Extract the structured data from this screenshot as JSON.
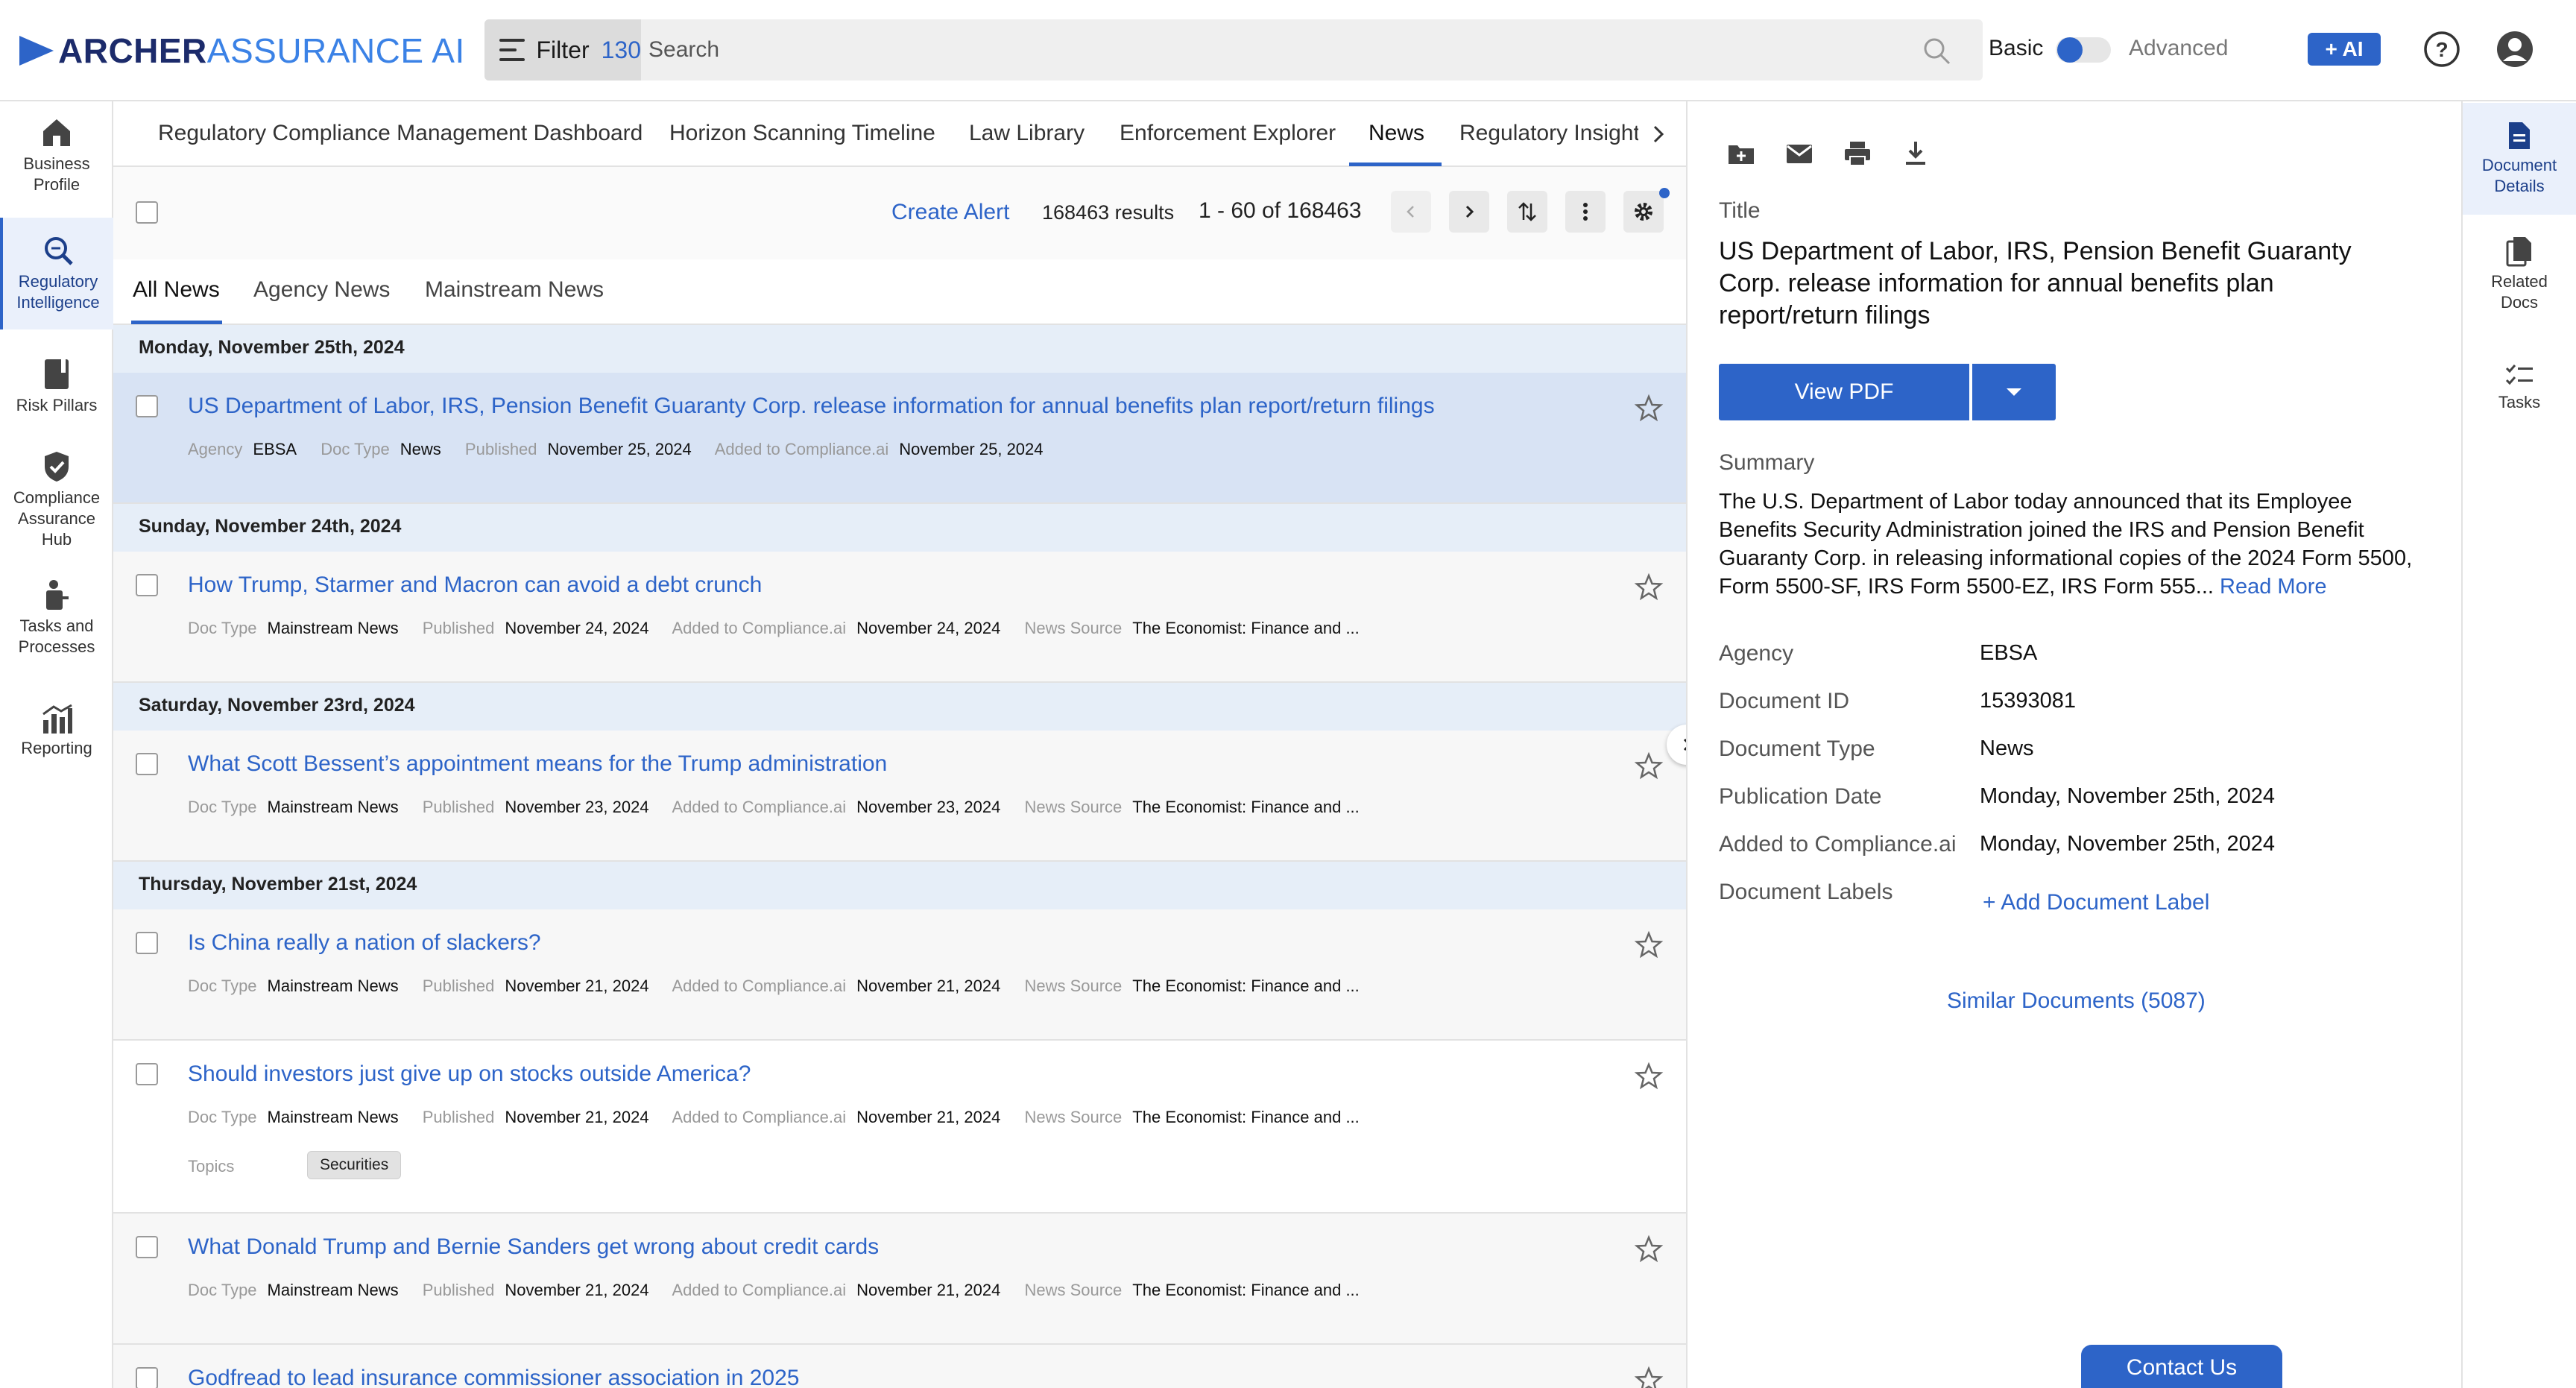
{
  "brand": {
    "part1": "ARCHER",
    "part2": "ASSURANCE AI"
  },
  "header": {
    "filter_label": "Filter",
    "filter_count": "130",
    "search_placeholder": "Search",
    "mode_basic": "Basic",
    "mode_advanced": "Advanced",
    "ai_label": "+ AI"
  },
  "left_nav": [
    {
      "label1": "Business",
      "label2": "Profile",
      "icon": "building-icon"
    },
    {
      "label1": "Regulatory",
      "label2": "Intelligence",
      "icon": "search-icon",
      "active": true
    },
    {
      "label1": "Risk Pillars",
      "label2": "",
      "icon": "book-icon"
    },
    {
      "label1": "Compliance",
      "label2": "Assurance",
      "label3": "Hub",
      "icon": "shield-icon"
    },
    {
      "label1": "Tasks and",
      "label2": "Processes",
      "icon": "task-icon"
    },
    {
      "label1": "Reporting",
      "label2": "",
      "icon": "chart-icon"
    }
  ],
  "main_tabs": [
    "Regulatory Compliance Management Dashboard",
    "Horizon Scanning Timeline",
    "Law Library",
    "Enforcement Explorer",
    "News",
    "Regulatory Insight"
  ],
  "toolbar": {
    "create_alert": "Create Alert",
    "results": "168463 results",
    "pager": "1 - 60 of 168463"
  },
  "sub_tabs": [
    "All News",
    "Agency News",
    "Mainstream News"
  ],
  "groups": [
    {
      "date": "Monday, November 25th, 2024"
    },
    {
      "date": "Sunday, November 24th, 2024"
    },
    {
      "date": "Saturday, November 23rd, 2024"
    },
    {
      "date": "Thursday, November 21st, 2024"
    }
  ],
  "items": [
    {
      "title": "US Department of Labor, IRS, Pension Benefit Guaranty Corp. release information for annual benefits plan report/return filings",
      "meta": [
        [
          "Agency",
          "EBSA"
        ],
        [
          "Doc Type",
          "News"
        ],
        [
          "Published",
          "November 25, 2024"
        ],
        [
          "Added to Compliance.ai",
          "November 25, 2024"
        ]
      ]
    },
    {
      "title": "How Trump, Starmer and Macron can avoid a debt crunch",
      "meta": [
        [
          "Doc Type",
          "Mainstream News"
        ],
        [
          "Published",
          "November 24, 2024"
        ],
        [
          "Added to Compliance.ai",
          "November 24, 2024"
        ],
        [
          "News Source",
          "The Economist: Finance and ..."
        ]
      ]
    },
    {
      "title": "What Scott Bessent’s appointment means for the Trump administration",
      "meta": [
        [
          "Doc Type",
          "Mainstream News"
        ],
        [
          "Published",
          "November 23, 2024"
        ],
        [
          "Added to Compliance.ai",
          "November 23, 2024"
        ],
        [
          "News Source",
          "The Economist: Finance and ..."
        ]
      ]
    },
    {
      "title": "Is China really a nation of slackers?",
      "meta": [
        [
          "Doc Type",
          "Mainstream News"
        ],
        [
          "Published",
          "November 21, 2024"
        ],
        [
          "Added to Compliance.ai",
          "November 21, 2024"
        ],
        [
          "News Source",
          "The Economist: Finance and ..."
        ]
      ]
    },
    {
      "title": "Should investors just give up on stocks outside America?",
      "meta": [
        [
          "Doc Type",
          "Mainstream News"
        ],
        [
          "Published",
          "November 21, 2024"
        ],
        [
          "Added to Compliance.ai",
          "November 21, 2024"
        ],
        [
          "News Source",
          "The Economist: Finance and ..."
        ]
      ],
      "topics_label": "Topics",
      "topic": "Securities"
    },
    {
      "title": "What Donald Trump and Bernie Sanders get wrong about credit cards",
      "meta": [
        [
          "Doc Type",
          "Mainstream News"
        ],
        [
          "Published",
          "November 21, 2024"
        ],
        [
          "Added to Compliance.ai",
          "November 21, 2024"
        ],
        [
          "News Source",
          "The Economist: Finance and ..."
        ]
      ]
    },
    {
      "title": "Godfread to lead insurance commissioner association in 2025",
      "meta": []
    }
  ],
  "details": {
    "title_label": "Title",
    "title": "US Department of Labor, IRS, Pension Benefit Guaranty Corp. release information for annual benefits plan report/return filings",
    "view_pdf": "View PDF",
    "summary_label": "Summary",
    "summary": "The U.S. Department of Labor today announced that its Employee Benefits Security Administration joined the IRS and Pension Benefit Guaranty Corp. in releasing informational copies of the 2024 Form 5500, Form 5500-SF, IRS Form 5500-EZ, IRS Form 555...",
    "read_more": "Read More",
    "fields": [
      [
        "Agency",
        "EBSA"
      ],
      [
        "Document ID",
        "15393081"
      ],
      [
        "Document Type",
        "News"
      ],
      [
        "Publication Date",
        "Monday, November 25th, 2024"
      ],
      [
        "Added to Compliance.ai",
        "Monday, November 25th, 2024"
      ]
    ],
    "labels_label": "Document Labels",
    "add_label": "+ Add Document Label",
    "similar": "Similar Documents (5087)",
    "contact": "Contact Us"
  },
  "right_rail": [
    {
      "label1": "Document",
      "label2": "Details",
      "icon": "document-icon",
      "active": true
    },
    {
      "label1": "Related",
      "label2": "Docs",
      "icon": "documents-icon"
    },
    {
      "label1": "Tasks",
      "label2": "",
      "icon": "checklist-icon"
    }
  ],
  "colors": {
    "accent": "#2d64c8",
    "selected_row": "#d8e3f4",
    "date_header": "#e6eef8"
  }
}
